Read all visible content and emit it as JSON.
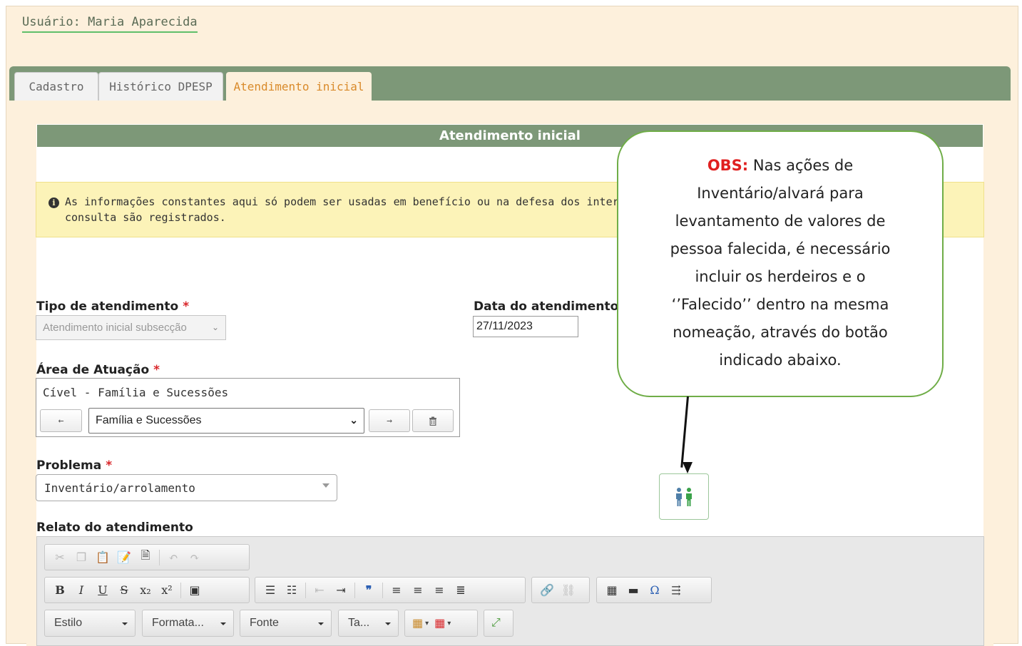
{
  "header": {
    "user_label": "Usuário: Maria Aparecida"
  },
  "tabs": [
    {
      "label": "Cadastro",
      "active": false
    },
    {
      "label": "Histórico DPESP",
      "active": false
    },
    {
      "label": "Atendimento inicial",
      "active": true
    }
  ],
  "section": {
    "title": "Atendimento inicial"
  },
  "notice": {
    "line1": "As informações constantes aqui só podem ser usadas em benefício ou na defesa dos intere",
    "line2": "consulta são registrados."
  },
  "form": {
    "tipo_label": "Tipo de atendimento",
    "tipo_value": "Atendimento inicial subsecção",
    "data_label": "Data do atendimento",
    "data_value": "27/11/2023",
    "area_label": "Área de Atuação",
    "area_selected": "Cível - Família e Sucessões",
    "area_select_value": "Família e Sucessões",
    "problema_label": "Problema",
    "problema_value": "Inventário/arrolamento",
    "relato_label": "Relato do atendimento",
    "required_mark": "*"
  },
  "editor": {
    "combos": [
      "Estilo",
      "Formata...",
      "Fonte",
      "Ta..."
    ]
  },
  "callout": {
    "obs_label": "OBS:",
    "text": "Nas ações de Inventário/alvará para levantamento de valores de pessoa falecida, é necessário incluir os herdeiros e o ‘’Falecido’’ dentro na mesma nomeação, através do botão indicado abaixo."
  },
  "colors": {
    "panel_bg": "#fdf0dc",
    "tabbar_green": "#7d9878",
    "active_tab_text": "#d98a2a",
    "notice_bg": "#fcf3b8",
    "required_red": "#d9262a",
    "callout_border": "#6fad47",
    "obs_red": "#e02020"
  },
  "icons": [
    "info-icon",
    "arrow-left-icon",
    "arrow-right-icon",
    "trash-icon",
    "people-icon"
  ]
}
